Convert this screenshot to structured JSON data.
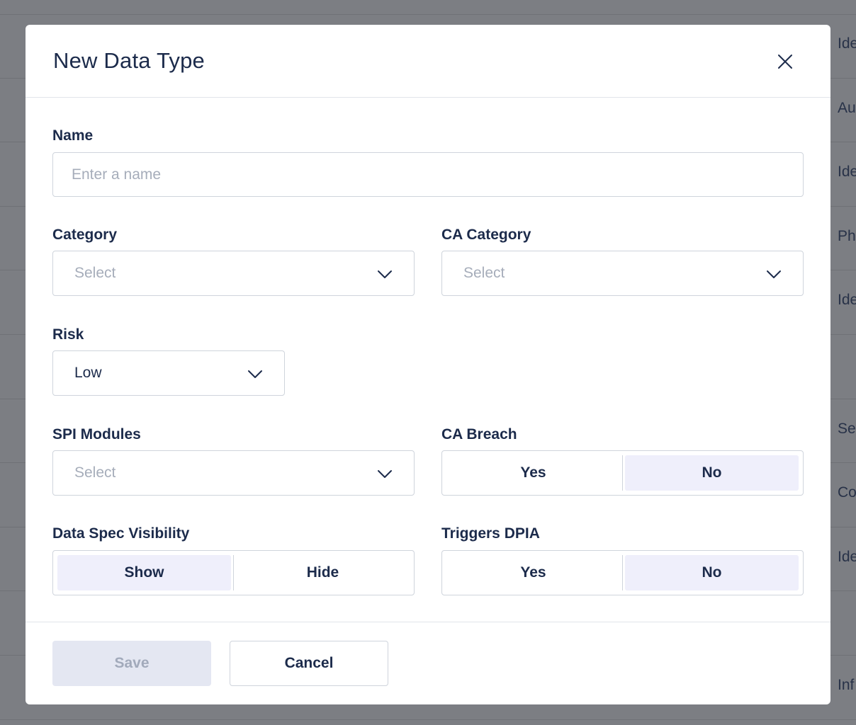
{
  "background": {
    "rows": [
      "Ide",
      "Au",
      "Ide",
      "Ph",
      "Ide",
      "",
      "Se",
      "Co",
      "Ide",
      "",
      "Inf"
    ]
  },
  "modal": {
    "title": "New Data Type",
    "close_icon": "close-icon",
    "fields": {
      "name": {
        "label": "Name",
        "value": "",
        "placeholder": "Enter a name"
      },
      "category": {
        "label": "Category",
        "value": "Select"
      },
      "ca_category": {
        "label": "CA Category",
        "value": "Select"
      },
      "risk": {
        "label": "Risk",
        "value": "Low"
      },
      "spi_modules": {
        "label": "SPI Modules",
        "value": "Select"
      },
      "ca_breach": {
        "label": "CA Breach",
        "options": [
          "Yes",
          "No"
        ],
        "selected": "No"
      },
      "data_spec_visibility": {
        "label": "Data Spec Visibility",
        "options": [
          "Show",
          "Hide"
        ],
        "selected": "Show"
      },
      "triggers_dpia": {
        "label": "Triggers DPIA",
        "options": [
          "Yes",
          "No"
        ],
        "selected": "No"
      }
    },
    "footer": {
      "save_label": "Save",
      "cancel_label": "Cancel"
    }
  },
  "colors": {
    "text": "#1c2b4b",
    "placeholder": "#a6adba",
    "border": "#cfd4dc",
    "toggle_active": "#efeffb",
    "save_disabled_bg": "#e4e7f2",
    "overlay": "#7c7e83"
  }
}
